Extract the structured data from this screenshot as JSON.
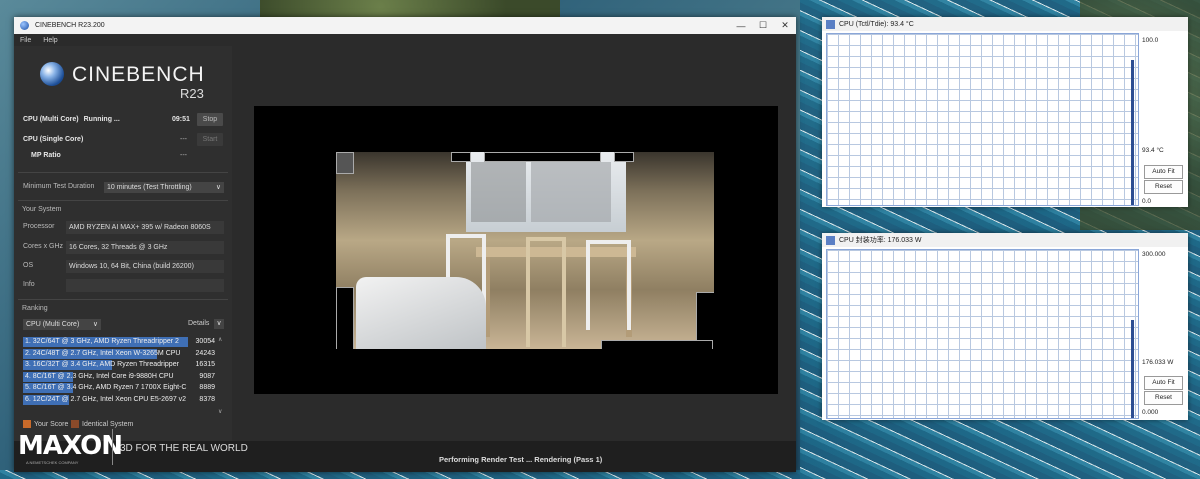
{
  "cinebench": {
    "window_title": "CINEBENCH R23.200",
    "menu": [
      "File",
      "Help"
    ],
    "logo_name": "CINEBENCH",
    "logo_version": "R23",
    "tests": {
      "multi_label": "CPU (Multi Core)",
      "multi_status": "Running ...",
      "multi_time": "09:51",
      "stop_label": "Stop",
      "single_label": "CPU (Single Core)",
      "single_value": "---",
      "start_label": "Start",
      "mp_label": "MP Ratio",
      "mp_value": "---"
    },
    "min_duration_label": "Minimum Test Duration",
    "min_duration_value": "10 minutes (Test Throttling)",
    "your_system_title": "Your System",
    "system": {
      "processor_label": "Processor",
      "processor_value": "AMD RYZEN AI MAX+ 395 w/ Radeon 8060S",
      "cores_label": "Cores x GHz",
      "cores_value": "16 Cores, 32 Threads @ 3 GHz",
      "os_label": "OS",
      "os_value": "Windows 10, 64 Bit, China (build 26200)",
      "info_label": "Info",
      "info_value": ""
    },
    "ranking_title": "Ranking",
    "ranking_select": "CPU (Multi Core)",
    "details_label": "Details",
    "ranking": [
      {
        "text": "1. 32C/64T @ 3 GHz, AMD Ryzen Threadripper 2",
        "score": "30054",
        "bar": 1.0
      },
      {
        "text": "2. 24C/48T @ 2.7 GHz, Intel Xeon W-3265M CPU",
        "score": "24243",
        "bar": 0.81
      },
      {
        "text": "3. 16C/32T @ 3.4 GHz, AMD Ryzen Threadripper",
        "score": "16315",
        "bar": 0.54
      },
      {
        "text": "4. 8C/16T @ 2.3 GHz, Intel Core i9-9880H CPU",
        "score": "9087",
        "bar": 0.3
      },
      {
        "text": "5. 8C/16T @ 3.4 GHz, AMD Ryzen 7 1700X Eight-C",
        "score": "8889",
        "bar": 0.3
      },
      {
        "text": "6. 12C/24T @ 2.7 GHz, Intel Xeon CPU E5-2697 v2",
        "score": "8378",
        "bar": 0.28
      }
    ],
    "legend_your_score": "Your Score",
    "legend_identical": "Identical System",
    "maxon": "MAXON",
    "maxon_sub": "A NEMETSCHEK COMPANY",
    "tagline": "3D FOR THE REAL WORLD",
    "status": "Performing Render Test ... Rendering (Pass 1)"
  },
  "monitor_temp": {
    "title": "CPU (Tctl/Tdie): 93.4 °C",
    "max_value": "100.0",
    "current_value": "93.4 °C",
    "min_value": "0.0",
    "autofit_label": "Auto Fit",
    "reset_label": "Reset"
  },
  "monitor_power": {
    "title": "CPU 封装功率: 176.033 W",
    "max_value": "300.000",
    "current_value": "176.033 W",
    "min_value": "0.000",
    "autofit_label": "Auto Fit",
    "reset_label": "Reset"
  },
  "colors": {
    "rank_bar": "#3f6fb5",
    "your_score": "#c86a2a",
    "identical": "#8a4a2a",
    "graph_line": "#2d4e93"
  }
}
